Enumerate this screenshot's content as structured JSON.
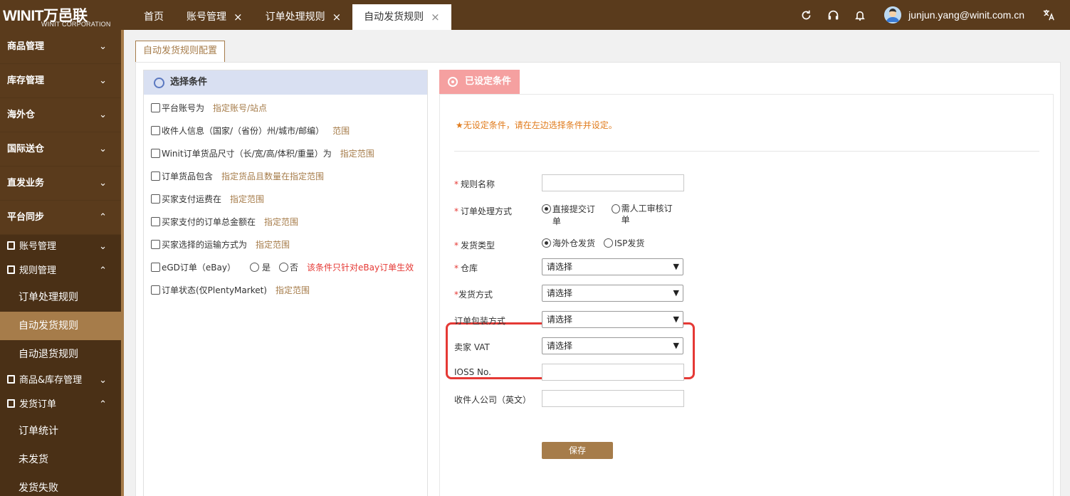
{
  "brand": {
    "name": "WINIT万邑联",
    "subtitle": "WINIT CORPORATION"
  },
  "header": {
    "tabs": [
      {
        "label": "首页",
        "closable": false
      },
      {
        "label": "账号管理",
        "closable": true
      },
      {
        "label": "订单处理规则",
        "closable": true
      },
      {
        "label": "自动发货规则",
        "closable": true,
        "active": true
      }
    ],
    "close_glyph": "×",
    "user_email": "junjun.yang@winit.com.cn",
    "icons": [
      "refresh-icon",
      "headset-icon",
      "bell-icon",
      "avatar",
      "translate-icon"
    ]
  },
  "sidebar": {
    "groups": [
      {
        "label": "商品管理",
        "chevron": "⌄"
      },
      {
        "label": "库存管理",
        "chevron": "⌄"
      },
      {
        "label": "海外仓",
        "chevron": "⌄"
      },
      {
        "label": "国际送仓",
        "chevron": "⌄"
      },
      {
        "label": "直发业务",
        "chevron": "⌄"
      },
      {
        "label": "平台同步",
        "chevron": "⌃"
      }
    ],
    "subs": [
      {
        "label": "账号管理",
        "chevron": "⌄"
      },
      {
        "label": "规则管理",
        "chevron": "⌃"
      },
      {
        "label": "商品&库存管理",
        "chevron": "⌄"
      },
      {
        "label": "发货订单",
        "chevron": "⌃"
      }
    ],
    "leaves": [
      {
        "label": "订单处理规则"
      },
      {
        "label": "自动发货规则",
        "active": true
      },
      {
        "label": "自动退货规则"
      },
      {
        "label": "订单统计"
      },
      {
        "label": "未发货"
      },
      {
        "label": "发货失败"
      }
    ]
  },
  "page": {
    "subtab": "自动发货规则配置",
    "left_panel": {
      "title": "选择条件",
      "conditions": [
        {
          "label": "平台账号为",
          "hint": "指定账号/站点"
        },
        {
          "label": "收件人信息（国家/（省份）州/城市/邮编）",
          "hint": "范围"
        },
        {
          "label": "Winit订单货品尺寸（长/宽/高/体积/重量）为",
          "hint": "指定范围"
        },
        {
          "label": "订单货品包含",
          "hint": "指定货品且数量在指定范围"
        },
        {
          "label": "买家支付运费在",
          "hint": "指定范围"
        },
        {
          "label": "买家支付的订单总金额在",
          "hint": "指定范围"
        },
        {
          "label": "买家选择的运输方式为",
          "hint": "指定范围"
        },
        {
          "label": "eGD订单（eBay）",
          "yes": "是",
          "no": "否",
          "note": "该条件只针对eBay订单生效"
        },
        {
          "label": "订单状态(仅PlentyMarket)",
          "hint": "指定范围"
        }
      ]
    },
    "right_panel": {
      "title": "已设定条件",
      "notice": "★无设定条件，请在左边选择条件并设定。",
      "form": {
        "rule_name": {
          "label": "规则名称",
          "required": true,
          "value": ""
        },
        "process_mode": {
          "label": "订单处理方式",
          "required": true,
          "options": [
            "直接提交订单",
            "需人工审核订单"
          ],
          "selected": "直接提交订单"
        },
        "ship_type": {
          "label": "发货类型",
          "required": true,
          "options": [
            "海外仓发货",
            "ISP发货"
          ],
          "selected": "海外仓发货"
        },
        "warehouse": {
          "label": "仓库",
          "required": true,
          "value": "请选择"
        },
        "ship_method": {
          "label": "发货方式",
          "required": true,
          "value": "请选择"
        },
        "packaging": {
          "label": "订单包装方式",
          "value": "请选择"
        },
        "seller_vat": {
          "label": "卖家 VAT",
          "value": "请选择"
        },
        "ioss": {
          "label": "IOSS No.",
          "value": ""
        },
        "receiver_company": {
          "label": "收件人公司（英文）",
          "value": ""
        }
      },
      "save_label": "保存"
    }
  }
}
